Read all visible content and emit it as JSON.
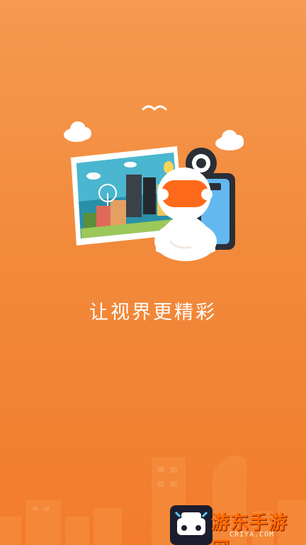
{
  "splash": {
    "tagline": "让视界更精彩"
  },
  "watermark": {
    "title": "游东手游网",
    "subtitle": "CRIYA.COM"
  },
  "colors": {
    "background_top": "#f59a4f",
    "background_bottom": "#f27c2c",
    "mascot_orange": "#ff6a1a",
    "camera_blue": "#5fb7f0"
  },
  "icons": [
    "cloud-icon",
    "bird-icon",
    "photo-icon",
    "camera-icon",
    "mascot-icon",
    "skyline-icon"
  ]
}
